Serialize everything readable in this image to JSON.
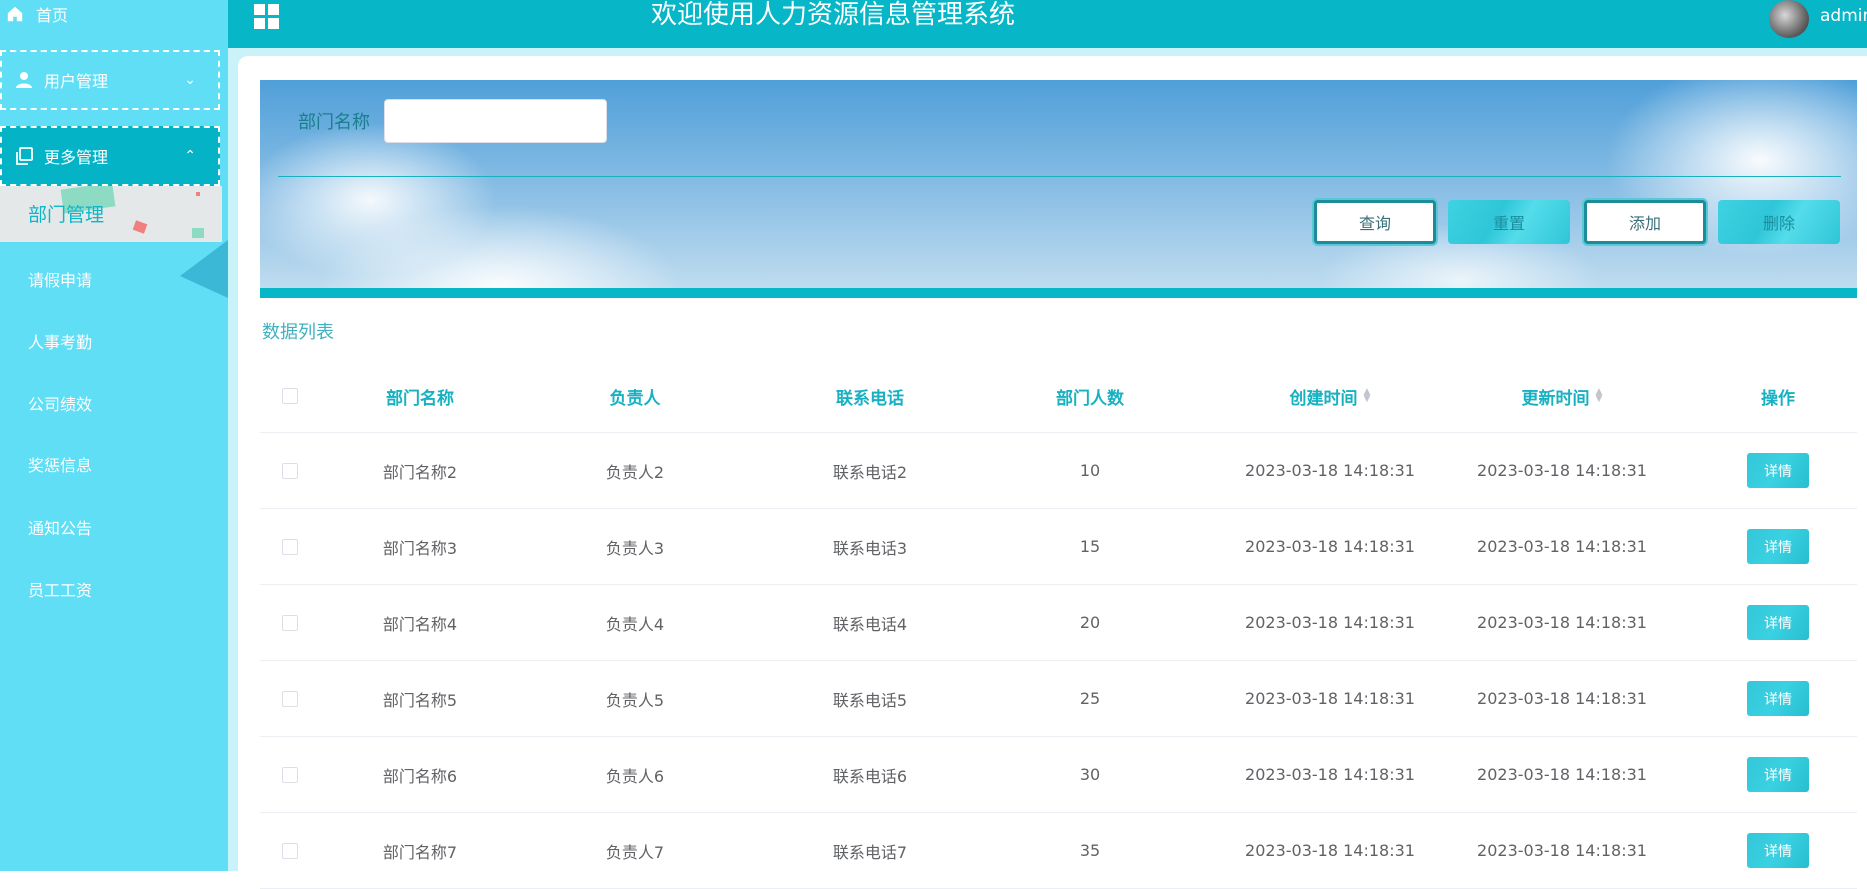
{
  "app": {
    "title": "欢迎使用人力资源信息管理系统",
    "user": "admin",
    "accent_color": "#07b6c7",
    "sidebar_color": "#5fdef5"
  },
  "sidebar": {
    "home": "首页",
    "user_mgmt": "用户管理",
    "more_mgmt": "更多管理",
    "active_item": "部门管理",
    "items": [
      "请假申请",
      "人事考勤",
      "公司绩效",
      "奖惩信息",
      "通知公告",
      "员工工资"
    ]
  },
  "search": {
    "label": "部门名称",
    "value": "",
    "buttons": {
      "query": "查询",
      "reset": "重置",
      "add": "添加",
      "delete": "删除"
    }
  },
  "list": {
    "title": "数据列表",
    "columns": [
      "部门名称",
      "负责人",
      "联系电话",
      "部门人数",
      "创建时间",
      "更新时间",
      "操作"
    ],
    "rows": [
      {
        "name": "部门名称2",
        "leader": "负责人2",
        "phone": "联系电话2",
        "count": "10",
        "created": "2023-03-18 14:18:31",
        "updated": "2023-03-18 14:18:31",
        "action": "详情"
      },
      {
        "name": "部门名称3",
        "leader": "负责人3",
        "phone": "联系电话3",
        "count": "15",
        "created": "2023-03-18 14:18:31",
        "updated": "2023-03-18 14:18:31",
        "action": "详情"
      },
      {
        "name": "部门名称4",
        "leader": "负责人4",
        "phone": "联系电话4",
        "count": "20",
        "created": "2023-03-18 14:18:31",
        "updated": "2023-03-18 14:18:31",
        "action": "详情"
      },
      {
        "name": "部门名称5",
        "leader": "负责人5",
        "phone": "联系电话5",
        "count": "25",
        "created": "2023-03-18 14:18:31",
        "updated": "2023-03-18 14:18:31",
        "action": "详情"
      },
      {
        "name": "部门名称6",
        "leader": "负责人6",
        "phone": "联系电话6",
        "count": "30",
        "created": "2023-03-18 14:18:31",
        "updated": "2023-03-18 14:18:31",
        "action": "详情"
      },
      {
        "name": "部门名称7",
        "leader": "负责人7",
        "phone": "联系电话7",
        "count": "35",
        "created": "2023-03-18 14:18:31",
        "updated": "2023-03-18 14:18:31",
        "action": "详情"
      }
    ]
  }
}
